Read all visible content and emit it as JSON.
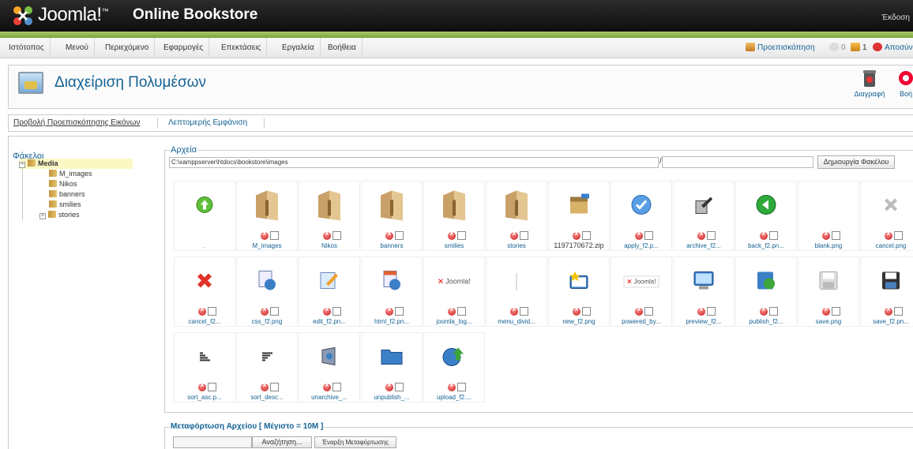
{
  "header": {
    "brand": "Joomla!",
    "brand_mark": "™",
    "site_title": "Online Bookstore",
    "version": "Έκδοση"
  },
  "menu": {
    "items": [
      {
        "label": "Ιστότοπος"
      },
      {
        "label": "Μενού"
      },
      {
        "label": "Περιεχόμενο"
      },
      {
        "label": "Εφαρμογές"
      },
      {
        "label": "Επεκτάσεις"
      },
      {
        "label": "Εργαλεία"
      },
      {
        "label": "Βοήθεια"
      }
    ],
    "preview": "Προεπισκόπηση",
    "messages_count": "0",
    "users_count": "1",
    "logout": "Αποσύν"
  },
  "toolbar": {
    "title": "Διαχείριση Πολυμέσων",
    "delete_label": "Διαγραφή",
    "help_label": "Βοή"
  },
  "submenu": {
    "thumbnails": "Προβολή Προεπισκόπησης Εικόνων",
    "detail": "Λεπτομερής Εμφάνιση"
  },
  "folders": {
    "title": "Φάκελοι",
    "root": "Media",
    "children": [
      "M_images",
      "Nikos",
      "banners",
      "smilies",
      "stories"
    ]
  },
  "files": {
    "legend": "Αρχεία",
    "path": "C:\\xamppserver\\htdocs\\bookstore\\images",
    "path_sep": "/",
    "create_folder": "Δημιουργία Φακέλου",
    "up_label": "..",
    "items": [
      {
        "name": "M_images",
        "icon": "folder-icon"
      },
      {
        "name": "Nikos",
        "icon": "folder-icon"
      },
      {
        "name": "banners",
        "icon": "folder-icon"
      },
      {
        "name": "smilies",
        "icon": "folder-icon"
      },
      {
        "name": "stories",
        "icon": "folder-icon"
      },
      {
        "name": "1197170672.zip",
        "icon": "zip-icon"
      },
      {
        "name": "apply_f2.p...",
        "icon": "apply-icon"
      },
      {
        "name": "archive_f2...",
        "icon": "archive-icon"
      },
      {
        "name": "back_f2.pn...",
        "icon": "back-icon"
      },
      {
        "name": "blank.png",
        "icon": "blank-icon"
      },
      {
        "name": "cancel.png",
        "icon": "cancel-gray-icon"
      },
      {
        "name": "cancel_f2...",
        "icon": "cancel-red-icon"
      },
      {
        "name": "css_f2.png",
        "icon": "css-icon"
      },
      {
        "name": "edit_f2.pn...",
        "icon": "edit-icon"
      },
      {
        "name": "html_f2.pn...",
        "icon": "html-icon"
      },
      {
        "name": "joomla_log...",
        "icon": "joomla-logo-icon"
      },
      {
        "name": "menu_divid...",
        "icon": "divider-icon"
      },
      {
        "name": "new_f2.png",
        "icon": "new-icon"
      },
      {
        "name": "powered_by...",
        "icon": "powered-by-icon"
      },
      {
        "name": "preview_f2...",
        "icon": "preview-icon"
      },
      {
        "name": "publish_f2...",
        "icon": "publish-icon"
      },
      {
        "name": "save.png",
        "icon": "save-gray-icon"
      },
      {
        "name": "save_f2.pn...",
        "icon": "save-icon"
      },
      {
        "name": "sort_asc.p...",
        "icon": "sort-asc-icon"
      },
      {
        "name": "sort_desc...",
        "icon": "sort-desc-icon"
      },
      {
        "name": "unarchive_...",
        "icon": "unarchive-icon"
      },
      {
        "name": "unpublish_...",
        "icon": "unpublish-icon"
      },
      {
        "name": "upload_f2....",
        "icon": "upload-icon"
      }
    ]
  },
  "upload": {
    "legend": "Μεταφόρτωση Αρχείου [ Μέγιστο = 10M ]",
    "browse": "Αναζήτηση...",
    "start": "Έναρξη Μεταφόρτωσης"
  },
  "colors": {
    "link": "#146294",
    "header_bg": "#1a1a1a",
    "accent_green": "#8ab84a"
  }
}
